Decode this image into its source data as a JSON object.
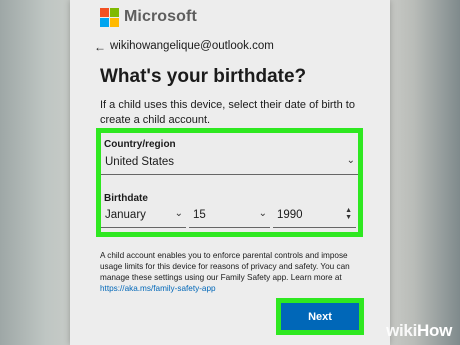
{
  "header": {
    "brand": "Microsoft"
  },
  "account": {
    "back_glyph": "←",
    "email": "wikihowangelique@outlook.com"
  },
  "page": {
    "title": "What's your birthdate?",
    "description": "If a child uses this device, select their date of birth to create a child account."
  },
  "form": {
    "country_label": "Country/region",
    "country_value": "United States",
    "birthdate_label": "Birthdate",
    "month_value": "January",
    "day_value": "15",
    "year_value": "1990"
  },
  "info": {
    "text": "A child account enables you to enforce parental controls and impose usage limits for this device for reasons of privacy and safety. You can manage these settings using our Family Safety app. Learn more at ",
    "link": "https://aka.ms/family-safety-app"
  },
  "buttons": {
    "next_label": "Next"
  },
  "watermark": {
    "part1": "wiki",
    "part2": "How"
  },
  "colors": {
    "highlight": "#2ee820",
    "primary_button": "#0067b8",
    "logo": [
      "#f25022",
      "#7fba00",
      "#00a4ef",
      "#ffb900"
    ]
  },
  "icons": {
    "dropdown": "chevron-down-icon",
    "spinner": "spinner-icon",
    "back": "back-arrow-icon"
  }
}
